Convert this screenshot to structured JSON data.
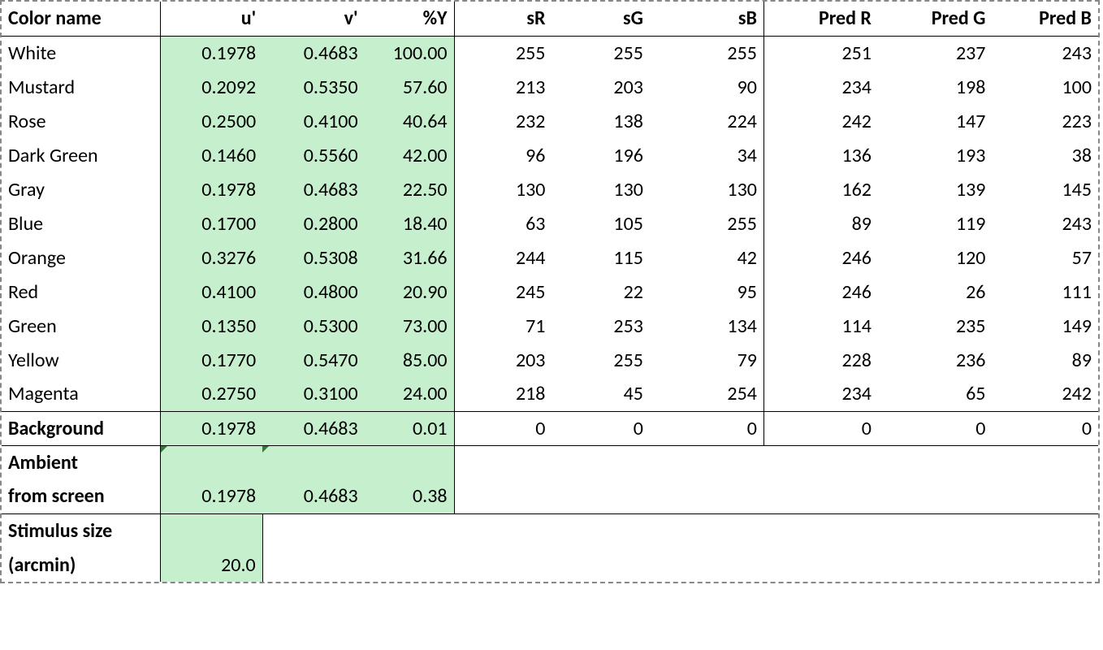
{
  "headers": {
    "name": "Color name",
    "u": "u'",
    "v": "v'",
    "y": "%Y",
    "sR": "sR",
    "sG": "sG",
    "sB": "sB",
    "pR": "Pred R",
    "pG": "Pred G",
    "pB": "Pred B"
  },
  "rows": [
    {
      "name": "White",
      "u": "0.1978",
      "v": "0.4683",
      "y": "100.00",
      "sR": "255",
      "sG": "255",
      "sB": "255",
      "pR": "251",
      "pG": "237",
      "pB": "243"
    },
    {
      "name": "Mustard",
      "u": "0.2092",
      "v": "0.5350",
      "y": "57.60",
      "sR": "213",
      "sG": "203",
      "sB": "90",
      "pR": "234",
      "pG": "198",
      "pB": "100"
    },
    {
      "name": "Rose",
      "u": "0.2500",
      "v": "0.4100",
      "y": "40.64",
      "sR": "232",
      "sG": "138",
      "sB": "224",
      "pR": "242",
      "pG": "147",
      "pB": "223"
    },
    {
      "name": "Dark Green",
      "u": "0.1460",
      "v": "0.5560",
      "y": "42.00",
      "sR": "96",
      "sG": "196",
      "sB": "34",
      "pR": "136",
      "pG": "193",
      "pB": "38"
    },
    {
      "name": "Gray",
      "u": "0.1978",
      "v": "0.4683",
      "y": "22.50",
      "sR": "130",
      "sG": "130",
      "sB": "130",
      "pR": "162",
      "pG": "139",
      "pB": "145"
    },
    {
      "name": "Blue",
      "u": "0.1700",
      "v": "0.2800",
      "y": "18.40",
      "sR": "63",
      "sG": "105",
      "sB": "255",
      "pR": "89",
      "pG": "119",
      "pB": "243"
    },
    {
      "name": "Orange",
      "u": "0.3276",
      "v": "0.5308",
      "y": "31.66",
      "sR": "244",
      "sG": "115",
      "sB": "42",
      "pR": "246",
      "pG": "120",
      "pB": "57"
    },
    {
      "name": "Red",
      "u": "0.4100",
      "v": "0.4800",
      "y": "20.90",
      "sR": "245",
      "sG": "22",
      "sB": "95",
      "pR": "246",
      "pG": "26",
      "pB": "111"
    },
    {
      "name": "Green",
      "u": "0.1350",
      "v": "0.5300",
      "y": "73.00",
      "sR": "71",
      "sG": "253",
      "sB": "134",
      "pR": "114",
      "pG": "235",
      "pB": "149"
    },
    {
      "name": "Yellow",
      "u": "0.1770",
      "v": "0.5470",
      "y": "85.00",
      "sR": "203",
      "sG": "255",
      "sB": "79",
      "pR": "228",
      "pG": "236",
      "pB": "89"
    },
    {
      "name": "Magenta",
      "u": "0.2750",
      "v": "0.3100",
      "y": "24.00",
      "sR": "218",
      "sG": "45",
      "sB": "254",
      "pR": "234",
      "pG": "65",
      "pB": "242"
    }
  ],
  "background": {
    "label": "Background",
    "u": "0.1978",
    "v": "0.4683",
    "y": "0.01",
    "sR": "0",
    "sG": "0",
    "sB": "0",
    "pR": "0",
    "pG": "0",
    "pB": "0"
  },
  "ambient": {
    "label1": "Ambient",
    "label2": "from screen",
    "u": "0.1978",
    "v": "0.4683",
    "y": "0.38"
  },
  "stimulus": {
    "label1": "Stimulus size",
    "label2": "(arcmin)",
    "value": "20.0"
  }
}
